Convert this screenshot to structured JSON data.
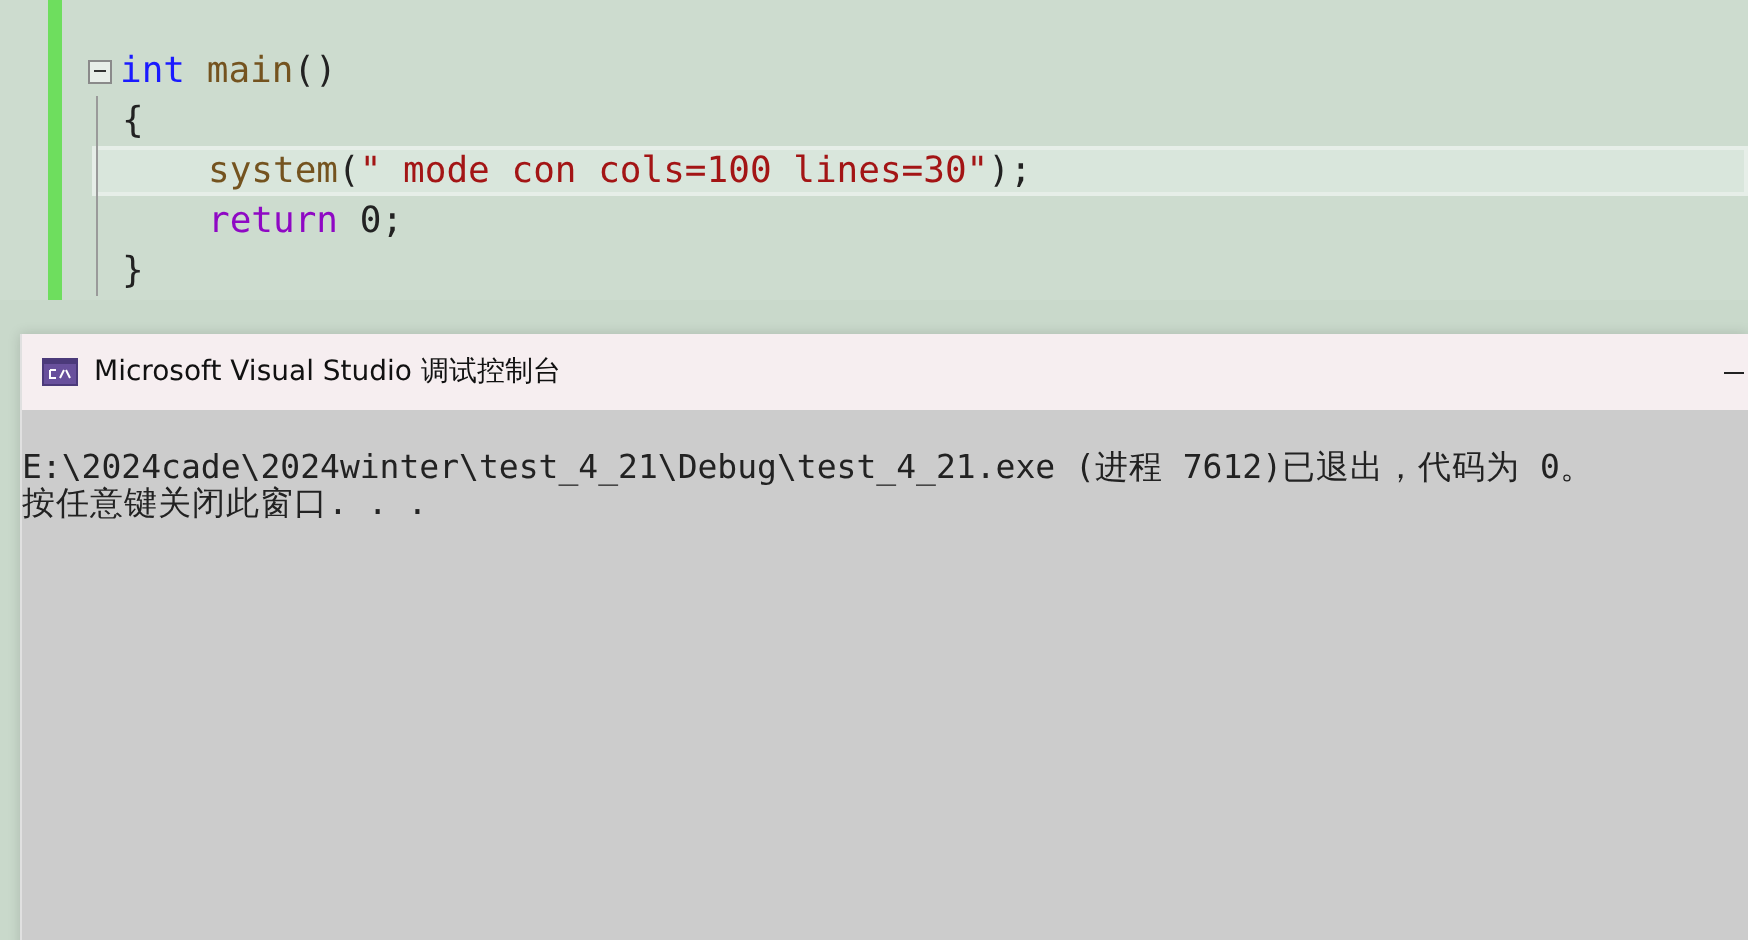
{
  "editor": {
    "lines": [
      {
        "kind": "fold-start",
        "current": false,
        "tokens": [
          {
            "kind": "keyword",
            "text": "int "
          },
          {
            "kind": "function",
            "text": "main"
          },
          {
            "kind": "punct",
            "text": "()"
          }
        ]
      },
      {
        "kind": "block",
        "current": false,
        "tokens": [
          {
            "kind": "punct",
            "text": "{"
          }
        ],
        "children": [
          {
            "kind": "block",
            "current": true,
            "tokens": [
              {
                "kind": "function",
                "text": "system"
              },
              {
                "kind": "punct",
                "text": "("
              },
              {
                "kind": "string",
                "text": "\" mode con cols=100 lines=30\""
              },
              {
                "kind": "punct",
                "text": ");"
              }
            ]
          },
          {
            "kind": "block",
            "current": false,
            "tokens": [
              {
                "kind": "control",
                "text": "return "
              },
              {
                "kind": "number",
                "text": "0"
              },
              {
                "kind": "punct",
                "text": ";"
              }
            ]
          }
        ]
      },
      {
        "kind": "block",
        "current": false,
        "tokens": [
          {
            "kind": "punct",
            "text": "}"
          }
        ]
      }
    ]
  },
  "console": {
    "title": "Microsoft Visual Studio 调试控制台",
    "output": [
      "E:\\2024cade\\2024winter\\test_4_21\\Debug\\test_4_21.exe (进程 7612)已退出，代码为 0。",
      "按任意键关闭此窗口. . ."
    ]
  }
}
